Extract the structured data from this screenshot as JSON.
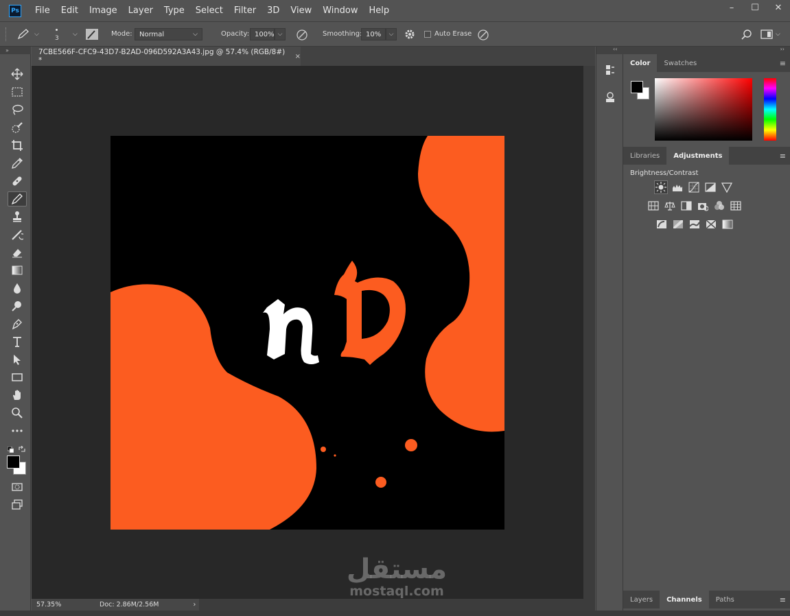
{
  "app": {
    "logo": "Ps",
    "window_buttons": [
      "–",
      "☐",
      "✕"
    ]
  },
  "menu": [
    "File",
    "Edit",
    "Image",
    "Layer",
    "Type",
    "Select",
    "Filter",
    "3D",
    "View",
    "Window",
    "Help"
  ],
  "options": {
    "brush_size": "3",
    "mode_label": "Mode:",
    "mode_value": "Normal",
    "opacity_label": "Opacity:",
    "opacity_value": "100%",
    "smoothing_label": "Smoothing:",
    "smoothing_value": "10%",
    "auto_erase_label": "Auto Erase"
  },
  "toolbar": {
    "active_tool": "pencil-tool",
    "collapse": "»"
  },
  "document": {
    "tab_title": "7CBE566F-CFC9-43D7-B2AD-096D592A3A43.jpg @ 57.4% (RGB/8#) *",
    "close": "×",
    "zoom": "57.35%",
    "doc_size": "Doc: 2.86M/2.56M",
    "status_arrow": "›"
  },
  "artwork": {
    "background": "#000000",
    "accent": "#fc5c20",
    "letter_color": "#ffffff"
  },
  "watermark": {
    "arabic": "مستقل",
    "latin": "mostaql.com"
  },
  "panels": {
    "color_tabs": [
      "Color",
      "Swatches"
    ],
    "adjust_tabs": [
      "Libraries",
      "Adjustments"
    ],
    "adjust_title": "Brightness/Contrast",
    "bottom_tabs": [
      "Layers",
      "Channels",
      "Paths"
    ],
    "menu_icon": "≡",
    "collapse_left": "‹‹",
    "collapse_right": "››"
  }
}
